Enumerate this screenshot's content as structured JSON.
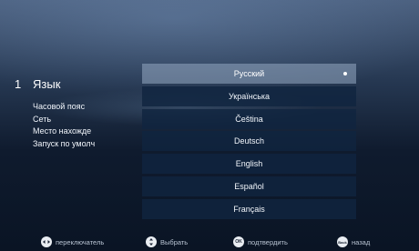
{
  "menu": {
    "number": "1",
    "title": "Язык",
    "items": [
      {
        "label": "Часовой пояс"
      },
      {
        "label": "Сеть"
      },
      {
        "label": "Место нахожде"
      },
      {
        "label": "Запуск по умолч"
      }
    ]
  },
  "languages": [
    {
      "label": "Русский",
      "selected": true
    },
    {
      "label": "Українська"
    },
    {
      "label": "Čeština"
    },
    {
      "label": "Deutsch"
    },
    {
      "label": "English"
    },
    {
      "label": "Español"
    },
    {
      "label": "Français"
    }
  ],
  "hints": {
    "switch_label": "переключатель",
    "select_label": "Выбрать",
    "ok_icon_text": "OK",
    "confirm_label": "подтвердить",
    "back_icon_text": "Back",
    "back_label": "назад"
  }
}
